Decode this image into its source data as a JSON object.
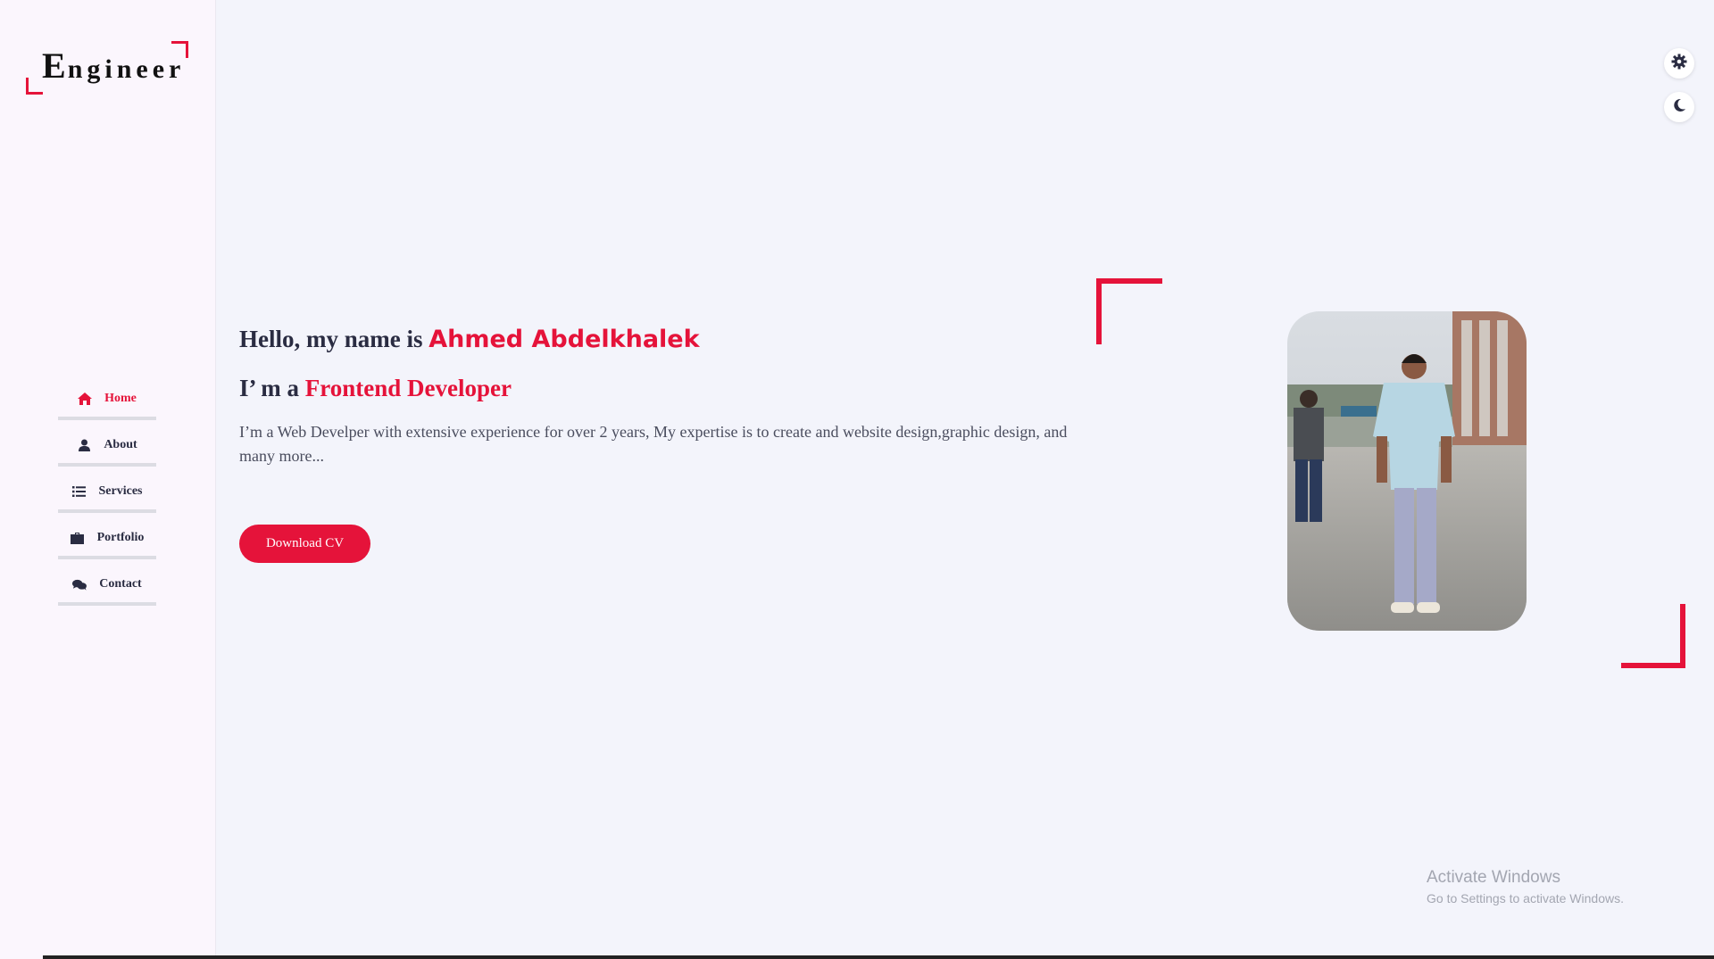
{
  "sidebar": {
    "logo": {
      "first_letter": "E",
      "rest": "ngineer"
    },
    "items": [
      {
        "label": "Home",
        "icon": "home-icon",
        "active": true
      },
      {
        "label": "About",
        "icon": "user-icon",
        "active": false
      },
      {
        "label": "Services",
        "icon": "list-icon",
        "active": false
      },
      {
        "label": "Portfolio",
        "icon": "briefcase-icon",
        "active": false
      },
      {
        "label": "Contact",
        "icon": "comments-icon",
        "active": false
      }
    ]
  },
  "hero": {
    "greeting_prefix": "Hello, my name is",
    "name": "Ahmed Abdelkhalek",
    "role_prefix": "I’ m a",
    "role": "Frontend Developer",
    "description": "I’m a Web Develper with extensive experience for over 2 years, My expertise is to create and website design,graphic design, and many more...",
    "cv_button": "Download CV",
    "photo_icon": "profile-photo"
  },
  "controls": {
    "settings_icon": "gear-icon",
    "theme_icon": "moon-icon"
  },
  "watermark": {
    "title": "Activate Windows",
    "subtitle": "Go to Settings to activate Windows."
  },
  "colors": {
    "accent": "#e5133a",
    "text": "#2a2c42",
    "background": "#f3f4fb",
    "sidebar": "#fbf6fd"
  }
}
